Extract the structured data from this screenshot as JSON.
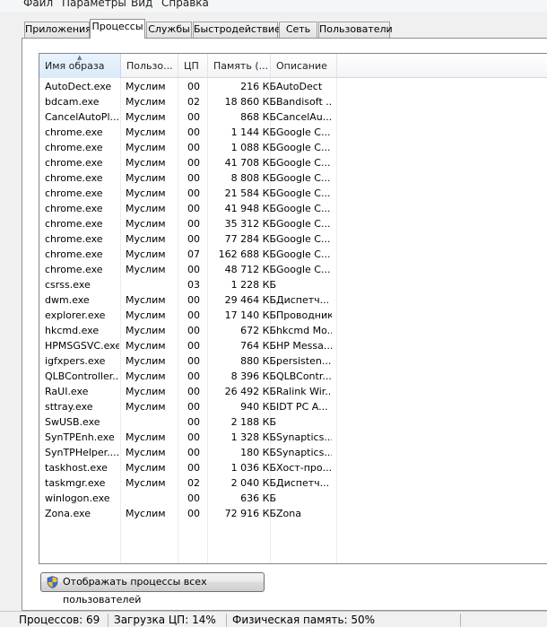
{
  "menu": [
    "Файл",
    "Параметры",
    "Вид",
    "Справка"
  ],
  "tabs": [
    {
      "label": "Приложения",
      "active": false
    },
    {
      "label": "Процессы",
      "active": true
    },
    {
      "label": "Службы",
      "active": false
    },
    {
      "label": "Быстродействие",
      "active": false
    },
    {
      "label": "Сеть",
      "active": false
    },
    {
      "label": "Пользователи",
      "active": false
    }
  ],
  "columns": {
    "name": "Имя образа",
    "user": "Пользо...",
    "cpu": "ЦП",
    "memory": "Память (...",
    "description": "Описание",
    "sorted_column": "name"
  },
  "processes": [
    {
      "name": "AutoDect.exe",
      "user": "Муслим",
      "cpu": "00",
      "mem": "216 КБ",
      "desc": "AutoDect"
    },
    {
      "name": "bdcam.exe",
      "user": "Муслим",
      "cpu": "02",
      "mem": "18 860 КБ",
      "desc": "Bandisoft ..."
    },
    {
      "name": "CancelAutoPl...",
      "user": "Муслим",
      "cpu": "00",
      "mem": "868 КБ",
      "desc": "CancelAu..."
    },
    {
      "name": "chrome.exe",
      "user": "Муслим",
      "cpu": "00",
      "mem": "1 144 КБ",
      "desc": "Google C..."
    },
    {
      "name": "chrome.exe",
      "user": "Муслим",
      "cpu": "00",
      "mem": "1 088 КБ",
      "desc": "Google C..."
    },
    {
      "name": "chrome.exe",
      "user": "Муслим",
      "cpu": "00",
      "mem": "41 708 КБ",
      "desc": "Google C..."
    },
    {
      "name": "chrome.exe",
      "user": "Муслим",
      "cpu": "00",
      "mem": "8 808 КБ",
      "desc": "Google C..."
    },
    {
      "name": "chrome.exe",
      "user": "Муслим",
      "cpu": "00",
      "mem": "21 584 КБ",
      "desc": "Google C..."
    },
    {
      "name": "chrome.exe",
      "user": "Муслим",
      "cpu": "00",
      "mem": "41 948 КБ",
      "desc": "Google C..."
    },
    {
      "name": "chrome.exe",
      "user": "Муслим",
      "cpu": "00",
      "mem": "35 312 КБ",
      "desc": "Google C..."
    },
    {
      "name": "chrome.exe",
      "user": "Муслим",
      "cpu": "00",
      "mem": "77 284 КБ",
      "desc": "Google C..."
    },
    {
      "name": "chrome.exe",
      "user": "Муслим",
      "cpu": "07",
      "mem": "162 688 КБ",
      "desc": "Google C..."
    },
    {
      "name": "chrome.exe",
      "user": "Муслим",
      "cpu": "00",
      "mem": "48 712 КБ",
      "desc": "Google C..."
    },
    {
      "name": "csrss.exe",
      "user": "",
      "cpu": "03",
      "mem": "1 228 КБ",
      "desc": ""
    },
    {
      "name": "dwm.exe",
      "user": "Муслим",
      "cpu": "00",
      "mem": "29 464 КБ",
      "desc": "Диспетч..."
    },
    {
      "name": "explorer.exe",
      "user": "Муслим",
      "cpu": "00",
      "mem": "17 140 КБ",
      "desc": "Проводник"
    },
    {
      "name": "hkcmd.exe",
      "user": "Муслим",
      "cpu": "00",
      "mem": "672 КБ",
      "desc": "hkcmd Mo..."
    },
    {
      "name": "HPMSGSVC.exe",
      "user": "Муслим",
      "cpu": "00",
      "mem": "764 КБ",
      "desc": "HP Messa..."
    },
    {
      "name": "igfxpers.exe",
      "user": "Муслим",
      "cpu": "00",
      "mem": "880 КБ",
      "desc": "persisten..."
    },
    {
      "name": "QLBController...",
      "user": "Муслим",
      "cpu": "00",
      "mem": "8 396 КБ",
      "desc": "QLBContr..."
    },
    {
      "name": "RaUI.exe",
      "user": "Муслим",
      "cpu": "00",
      "mem": "26 492 КБ",
      "desc": "Ralink Wir..."
    },
    {
      "name": "sttray.exe",
      "user": "Муслим",
      "cpu": "00",
      "mem": "940 КБ",
      "desc": "IDT PC A..."
    },
    {
      "name": "SwUSB.exe",
      "user": "",
      "cpu": "00",
      "mem": "2 188 КБ",
      "desc": ""
    },
    {
      "name": "SynTPEnh.exe",
      "user": "Муслим",
      "cpu": "00",
      "mem": "1 328 КБ",
      "desc": "Synaptics..."
    },
    {
      "name": "SynTPHelper....",
      "user": "Муслим",
      "cpu": "00",
      "mem": "180 КБ",
      "desc": "Synaptics..."
    },
    {
      "name": "taskhost.exe",
      "user": "Муслим",
      "cpu": "00",
      "mem": "1 036 КБ",
      "desc": "Хост-про..."
    },
    {
      "name": "taskmgr.exe",
      "user": "Муслим",
      "cpu": "02",
      "mem": "2 040 КБ",
      "desc": "Диспетч..."
    },
    {
      "name": "winlogon.exe",
      "user": "",
      "cpu": "00",
      "mem": "636 КБ",
      "desc": ""
    },
    {
      "name": "Zona.exe",
      "user": "Муслим",
      "cpu": "00",
      "mem": "72 916 КБ",
      "desc": "Zona"
    }
  ],
  "show_all_button": "Отображать процессы всех пользователей",
  "icons": {
    "show_all_button": "uac-shield-icon",
    "sort": "sort-ascending-icon"
  },
  "status": {
    "processes": "Процессов: 69",
    "cpu": "Загрузка ЦП: 14%",
    "memory": "Физическая память: 50%"
  },
  "colors": {
    "selected_header": "#d9ebf9",
    "shield_blue": "#3f6fc6",
    "shield_yellow": "#f2c230"
  }
}
